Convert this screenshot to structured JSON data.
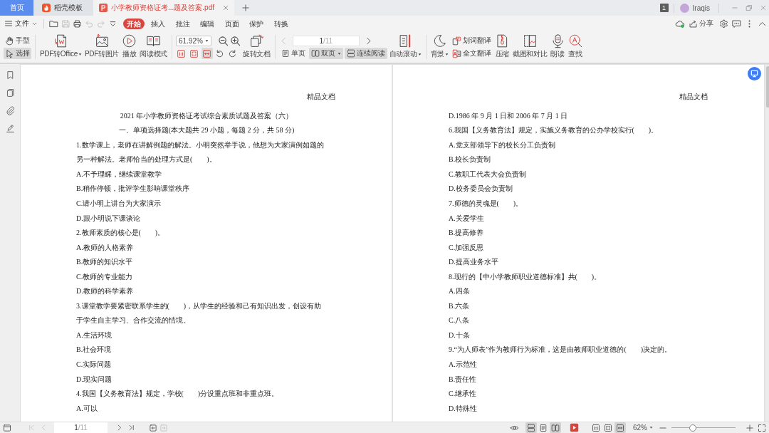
{
  "tabs": [
    {
      "label": "首页",
      "kind": "home",
      "selected": false
    },
    {
      "label": "稻壳模板",
      "kind": "template",
      "selected": false
    },
    {
      "label": "小学教师资格证考...题及答案.pdf",
      "kind": "pdf",
      "selected": true
    }
  ],
  "account": {
    "badge": "1",
    "user": "Iraqis"
  },
  "menu": {
    "file": "文件",
    "quick_access": [
      {
        "kind": "open",
        "disabled": false
      },
      {
        "kind": "save",
        "disabled": true
      },
      {
        "kind": "print",
        "disabled": false
      },
      {
        "kind": "undo",
        "disabled": true
      },
      {
        "kind": "redo",
        "disabled": true
      },
      {
        "kind": "customize",
        "disabled": false
      }
    ],
    "tabs": [
      {
        "label": "开始",
        "selected": true
      },
      {
        "label": "插入",
        "selected": false
      },
      {
        "label": "批注",
        "selected": false
      },
      {
        "label": "编辑",
        "selected": false
      },
      {
        "label": "页面",
        "selected": false
      },
      {
        "label": "保护",
        "selected": false
      },
      {
        "label": "转换",
        "selected": false
      }
    ],
    "share": "分享"
  },
  "toolbar": {
    "pointer_tools": [
      {
        "label": "手型",
        "kind": "hand",
        "selected": false
      },
      {
        "label": "选择",
        "kind": "select",
        "selected": true
      }
    ],
    "actions": [
      {
        "label": "PDF转Office",
        "kind": "pdf-office",
        "dropdown": true
      },
      {
        "label": "PDF转图片",
        "kind": "pdf-image",
        "dropdown": false
      },
      {
        "label": "播放",
        "kind": "play",
        "dropdown": false
      },
      {
        "label": "阅读模式",
        "kind": "read-mode",
        "dropdown": false
      }
    ],
    "zoom": {
      "value": "61.92%"
    },
    "view_buttons": [
      {
        "kind": "actual-size",
        "selected": false
      },
      {
        "kind": "fit-page",
        "selected": false
      },
      {
        "kind": "fit-width",
        "selected": true
      },
      {
        "kind": "rotate-left",
        "selected": false
      },
      {
        "kind": "rotate-right",
        "selected": false
      }
    ],
    "rotate": {
      "label": "旋转文档"
    },
    "page_nav": {
      "prev_disabled": true,
      "current": "1",
      "total": "/11",
      "next_disabled": false
    },
    "layouts": [
      {
        "label": "单页",
        "kind": "single",
        "selected": false,
        "dropdown": false
      },
      {
        "label": "双页",
        "kind": "double",
        "selected": true,
        "dropdown": true
      },
      {
        "label": "连续阅读",
        "kind": "continuous",
        "selected": true,
        "dropdown": false
      }
    ],
    "tools": [
      {
        "label": "自动滚动",
        "kind": "auto-scroll",
        "dropdown": true
      },
      {
        "label": "背景",
        "kind": "background",
        "dropdown": true
      }
    ],
    "translate": [
      {
        "label": "划词翻译",
        "kind": "word-translate"
      },
      {
        "label": "全文翻译",
        "kind": "full-translate"
      }
    ],
    "more_tools": [
      {
        "label": "压缩",
        "kind": "compress"
      },
      {
        "label": "截图和对比",
        "kind": "screenshot"
      },
      {
        "label": "朗读",
        "kind": "read-aloud"
      },
      {
        "label": "查找",
        "kind": "find"
      }
    ]
  },
  "pages": [
    {
      "header": "精品文档",
      "lines": [
        {
          "kind": "title",
          "text": "2021 年小学教师资格证考试综合素质试题及答案（六）"
        },
        {
          "kind": "section",
          "text": "一、单项选择题(本大题共 29 小题，每题 2 分，共 58 分)"
        },
        {
          "kind": "question",
          "text": "1.数学课上，老师在讲解例题的解法。小明突然举手说，他想为大家演例如题的另一种解法。老师恰当的处理方式是(　　)。"
        },
        {
          "kind": "option",
          "text": "A.不予理睬，继续课堂教学"
        },
        {
          "kind": "option",
          "text": "B.稍作停顿，批评学生影响课堂秩序"
        },
        {
          "kind": "option",
          "text": "C.请小明上讲台为大家演示"
        },
        {
          "kind": "option",
          "text": "D.跟小明说下课谈论"
        },
        {
          "kind": "question",
          "text": "2.教师素质的核心是(　　)。"
        },
        {
          "kind": "option",
          "text": "A.教师的人格素养"
        },
        {
          "kind": "option",
          "text": "B.教师的知识水平"
        },
        {
          "kind": "option",
          "text": "C.教师的专业能力"
        },
        {
          "kind": "option",
          "text": "D.教师的科学素养"
        },
        {
          "kind": "question",
          "text": "3.课堂教学要紧密联系学生的(　　)，从学生的经验和己有知识出发，创设有助于学生自主学习、合作交流的情境。"
        },
        {
          "kind": "option",
          "text": "A.生活环境"
        },
        {
          "kind": "option",
          "text": "B.社会环境"
        },
        {
          "kind": "option",
          "text": "C.实际问题"
        },
        {
          "kind": "option",
          "text": "D.现实问题"
        },
        {
          "kind": "question",
          "text": "4.我国【义务教育法】规定，学校(　　)分设重点班和非重点班。"
        },
        {
          "kind": "option",
          "text": "A.可以"
        }
      ]
    },
    {
      "header": "精品文档",
      "lines": [
        {
          "kind": "option",
          "text": "D.1986 年 9 月 1 日和 2006 年 7 月 1 日"
        },
        {
          "kind": "question",
          "text": "6.我国【义务教育法】规定，实施义务教育的公办学校实行(　　)。"
        },
        {
          "kind": "option",
          "text": "A.党支部领导下的校长分工负责制"
        },
        {
          "kind": "option",
          "text": "B.校长负责制"
        },
        {
          "kind": "option",
          "text": "C.教职工代表大会负责制"
        },
        {
          "kind": "option",
          "text": "D.校务委员会负责制"
        },
        {
          "kind": "question",
          "text": "7.师德的灵魂是(　　)。"
        },
        {
          "kind": "option",
          "text": "A.关爱学生"
        },
        {
          "kind": "option",
          "text": "B.提高修养"
        },
        {
          "kind": "option",
          "text": "C.加强反思"
        },
        {
          "kind": "option",
          "text": "D.提高业务水平"
        },
        {
          "kind": "question",
          "text": "8.现行的【中小学教师职业道德标准】共(　　)。"
        },
        {
          "kind": "option",
          "text": "A.四条"
        },
        {
          "kind": "option",
          "text": "B.六条"
        },
        {
          "kind": "option",
          "text": "C.八条"
        },
        {
          "kind": "option",
          "text": "D.十条"
        },
        {
          "kind": "question",
          "text": "9.“为人师表”作为教师行为标准，这是由教师职业道德的(　　)决定的。"
        },
        {
          "kind": "option",
          "text": "A.示范性"
        },
        {
          "kind": "option",
          "text": "B.责任性"
        },
        {
          "kind": "option",
          "text": "C.继承性"
        },
        {
          "kind": "option",
          "text": "D.特殊性"
        }
      ]
    }
  ],
  "status_bar": {
    "nav_back": [
      {
        "kind": "first",
        "disabled": true
      },
      {
        "kind": "prev",
        "disabled": true
      }
    ],
    "current": "1",
    "total": "/11",
    "nav_forward": [
      {
        "kind": "next",
        "disabled": false
      },
      {
        "kind": "last",
        "disabled": false
      }
    ],
    "history": [
      {
        "kind": "back",
        "disabled": false
      },
      {
        "kind": "forward",
        "disabled": true
      }
    ],
    "layouts": [
      {
        "kind": "continuous",
        "selected": true
      },
      {
        "kind": "single",
        "selected": false
      },
      {
        "kind": "double",
        "selected": true
      }
    ],
    "fit": [
      {
        "kind": "actual-size",
        "selected": false
      },
      {
        "kind": "fit-page",
        "selected": false
      },
      {
        "kind": "fit-width",
        "selected": true
      }
    ],
    "zoom": "62%",
    "zoom_slider": {
      "level": 0.33
    }
  }
}
